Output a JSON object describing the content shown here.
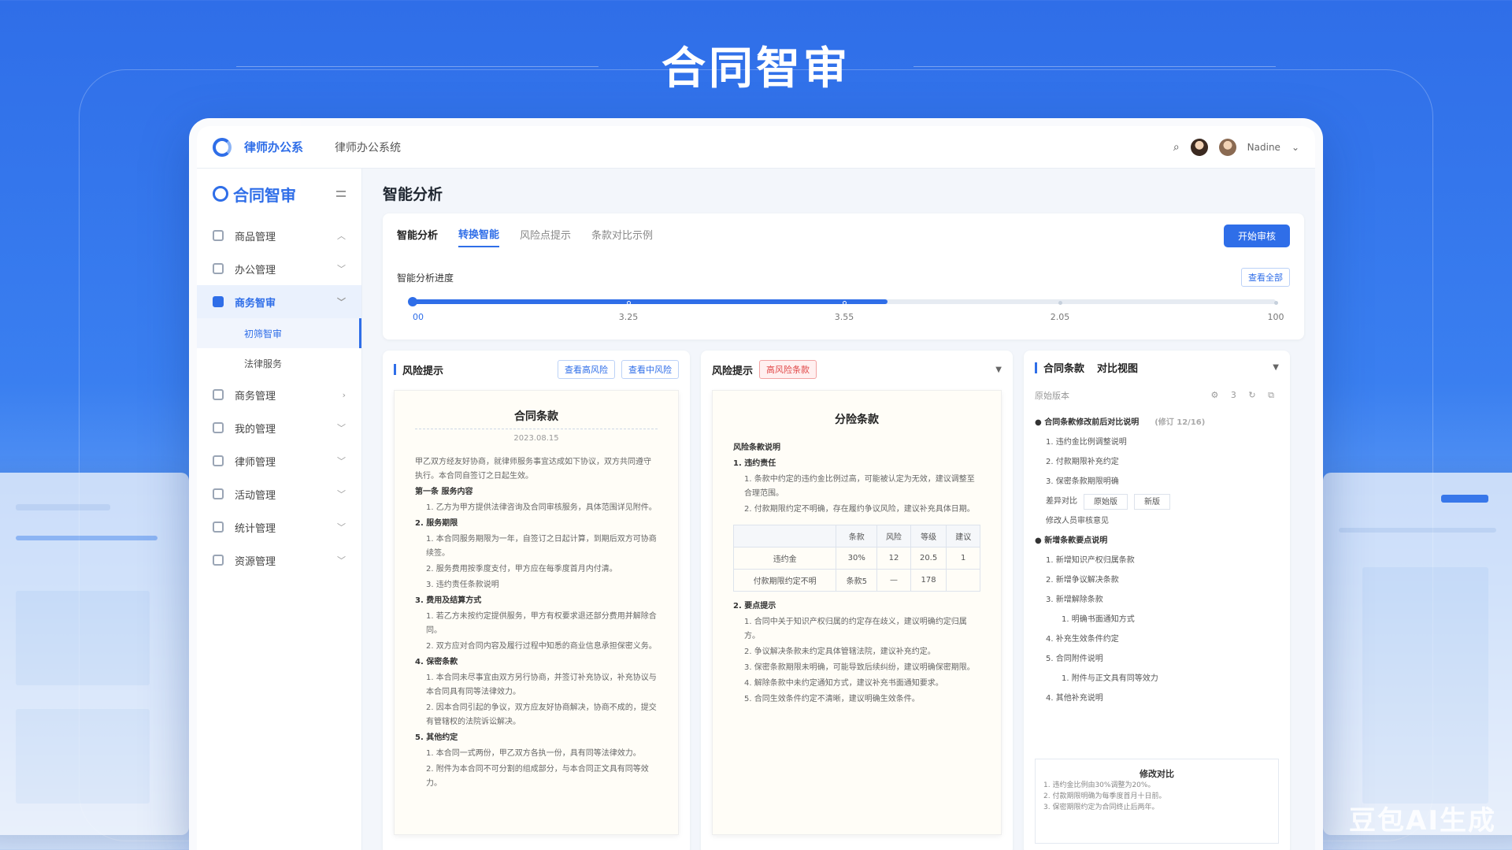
{
  "hero": {
    "title": "合同智审"
  },
  "topbar": {
    "brand": "律师办公系",
    "system_name": "律师办公系统",
    "user_name": "Nadine"
  },
  "sidebar": {
    "title": "合同智审",
    "items": [
      {
        "label": "商品管理",
        "chev": "︿"
      },
      {
        "label": "办公管理",
        "chev": "﹀"
      },
      {
        "label": "商务智审",
        "chev": "﹀",
        "active": true
      },
      {
        "label": "商务管理",
        "chev": "›"
      },
      {
        "label": "我的管理",
        "chev": "﹀"
      },
      {
        "label": "律师管理",
        "chev": "﹀"
      },
      {
        "label": "活动管理",
        "chev": "﹀"
      },
      {
        "label": "统计管理",
        "chev": "﹀"
      },
      {
        "label": "资源管理",
        "chev": "﹀"
      }
    ],
    "sub_items": [
      {
        "label": "初筛智审"
      },
      {
        "label": "法律服务"
      }
    ]
  },
  "main": {
    "page_title": "智能分析",
    "tabs": [
      {
        "label": "智能分析"
      },
      {
        "label": "转换智能"
      },
      {
        "label": "风险点提示"
      },
      {
        "label": "条款对比示例"
      }
    ],
    "primary_button": "开始审核",
    "progress": {
      "label": "智能分析进度",
      "mini_button": "查看全部",
      "value_percent": 55,
      "tick_labels": [
        "00",
        "3.25",
        "3.55",
        "2.05",
        "100"
      ]
    }
  },
  "panel_left": {
    "title": "风险提示",
    "tag1": "查看高风险",
    "tag2": "查看中风险",
    "doc": {
      "title": "合同条款",
      "date": "2023.08.15",
      "lines": [
        {
          "t": "甲乙双方经友好协商，就律师服务事宜达成如下协议，双方共同遵守执行。本合同自签订之日起生效。"
        },
        {
          "t": "第一条 服务内容",
          "h": true
        },
        {
          "t": "1. 乙方为甲方提供法律咨询及合同审核服务，具体范围详见附件。",
          "ind": true
        },
        {
          "t": "2. 服务期限",
          "h": true
        },
        {
          "t": "1. 本合同服务期限为一年，自签订之日起计算，到期后双方可协商续签。",
          "ind": true
        },
        {
          "t": "2. 服务费用按季度支付，甲方应在每季度首月内付清。",
          "ind": true
        },
        {
          "t": "3. 违约责任条款说明",
          "ind": true
        },
        {
          "t": "3. 费用及结算方式",
          "h": true
        },
        {
          "t": "1. 若乙方未按约定提供服务，甲方有权要求退还部分费用并解除合同。",
          "ind": true
        },
        {
          "t": "2. 双方应对合同内容及履行过程中知悉的商业信息承担保密义务。",
          "ind": true
        },
        {
          "t": "4. 保密条款",
          "h": true
        },
        {
          "t": "1. 本合同未尽事宜由双方另行协商，并签订补充协议，补充协议与本合同具有同等法律效力。",
          "ind": true
        },
        {
          "t": "2. 因本合同引起的争议，双方应友好协商解决，协商不成的，提交有管辖权的法院诉讼解决。",
          "ind": true
        },
        {
          "t": "5. 其他约定",
          "h": true
        },
        {
          "t": "1. 本合同一式两份，甲乙双方各执一份，具有同等法律效力。",
          "ind": true
        },
        {
          "t": "2. 附件为本合同不可分割的组成部分，与本合同正文具有同等效力。",
          "ind": true
        }
      ]
    }
  },
  "panel_mid": {
    "title": "风险提示",
    "tag": "高风险条款",
    "doc": {
      "title": "分险条款",
      "lines_top": [
        {
          "t": "风险条款说明",
          "h": true
        },
        {
          "t": "1. 违约责任",
          "h": true
        },
        {
          "t": "1. 条款中约定的违约金比例过高，可能被认定为无效，建议调整至合理范围。",
          "ind": true
        },
        {
          "t": "2. 付款期限约定不明确，存在履约争议风险，建议补充具体日期。",
          "ind": true
        }
      ],
      "table_header": [
        "",
        "条款",
        "风险",
        "等级",
        "建议"
      ],
      "table_rows": [
        [
          "违约金",
          "30%",
          "12",
          "20.5",
          "1"
        ],
        [
          "付款期限约定不明",
          "条款5",
          "—",
          "178",
          ""
        ]
      ],
      "lines_bottom": [
        {
          "t": "2. 要点提示",
          "h": true
        },
        {
          "t": "1. 合同中关于知识产权归属的约定存在歧义，建议明确约定归属方。",
          "ind": true
        },
        {
          "t": "2. 争议解决条款未约定具体管辖法院，建议补充约定。",
          "ind": true
        },
        {
          "t": "3. 保密条款期限未明确，可能导致后续纠纷，建议明确保密期限。",
          "ind": true
        },
        {
          "t": "4. 解除条款中未约定通知方式，建议补充书面通知要求。",
          "ind": true
        },
        {
          "t": "5. 合同生效条件约定不清晰，建议明确生效条件。",
          "ind": true
        }
      ]
    }
  },
  "panel_right": {
    "title": "合同条款",
    "title2": "对比视图",
    "tools_label": "原始版本",
    "counter": "3",
    "list": [
      {
        "t": "● 合同条款修改前后对比说明",
        "b": true,
        "note": "(修订 12/16)"
      },
      {
        "t": "1. 违约金比例调整说明",
        "c": "ind"
      },
      {
        "t": "2. 付款期限补充约定",
        "c": "ind"
      },
      {
        "t": "3. 保密条款期限明确",
        "c": "ind"
      },
      {
        "t": "● 新增条款要点说明",
        "b": true
      },
      {
        "t": "1. 新增知识产权归属条款",
        "c": "ind"
      },
      {
        "t": "2. 新增争议解决条款",
        "c": "ind"
      },
      {
        "t": "3. 新增解除条款",
        "c": "ind"
      },
      {
        "t": "1. 明确书面通知方式",
        "c": "ind2"
      },
      {
        "t": "4. 补充生效条件约定",
        "c": "ind"
      },
      {
        "t": "5. 合同附件说明",
        "c": "ind"
      },
      {
        "t": "1. 附件与正文具有同等效力",
        "c": "ind2"
      },
      {
        "t": "4. 其他补充说明",
        "c": "ind"
      }
    ],
    "row_label": "差异对比",
    "row_box1": "原始版",
    "row_box2": "新版",
    "row_sub": "修改人员审核意见",
    "diff": {
      "title": "修改对比",
      "lines": [
        "1. 违约金比例由30%调整为20%。",
        "2. 付款期限明确为每季度首月十日前。",
        "3. 保密期限约定为合同终止后两年。"
      ]
    }
  },
  "watermark": "豆包AI生成"
}
